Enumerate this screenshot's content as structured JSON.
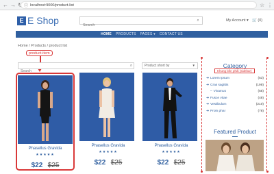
{
  "browser": {
    "url": "localhost:9000/product-list"
  },
  "header": {
    "logo_letter": "E",
    "logo_text": "E Shop",
    "search_placeholder": "Search",
    "account_label": "My Account ▾",
    "cart_label": "(0)"
  },
  "navbar": {
    "items": [
      {
        "label": "HOME",
        "active": true
      },
      {
        "label": "PRODUCTS"
      },
      {
        "label": "PAGES ▾"
      },
      {
        "label": "CONTACT US"
      }
    ]
  },
  "breadcrumb": "Home  /  Products  /  product list",
  "annotation": {
    "callout": "product-item"
  },
  "filters": {
    "search_placeholder": "Search",
    "sort_label": "Product short by"
  },
  "products": [
    {
      "title": "Phasellus Gravida",
      "stars": "★★★★★",
      "price": "$22",
      "old_price": "$25"
    },
    {
      "title": "Phasellus Gravida",
      "stars": "★★★★★",
      "price": "$22",
      "old_price": "$25"
    },
    {
      "title": "Phasellus Gravida",
      "stars": "★★★★★",
      "price": "$22",
      "old_price": "$25"
    }
  ],
  "sidebar": {
    "category_title": "Category",
    "category_note": "Khung bên phải (sidebar)",
    "categories": [
      {
        "name": "Lorem Ipsum",
        "count": "(53)"
      },
      {
        "name": "Cras sagittis",
        "count": "(198)"
      },
      {
        "name": "Vivamus",
        "count": "(55)"
      },
      {
        "name": "Fusce vitae",
        "count": "(48)"
      },
      {
        "name": "Vestibulum",
        "count": "(210)"
      },
      {
        "name": "Proin phar",
        "count": "(78)"
      }
    ],
    "featured_title": "Featured Product"
  },
  "colors": {
    "brand": "#2f5f9f",
    "annotation": "#d93838"
  }
}
